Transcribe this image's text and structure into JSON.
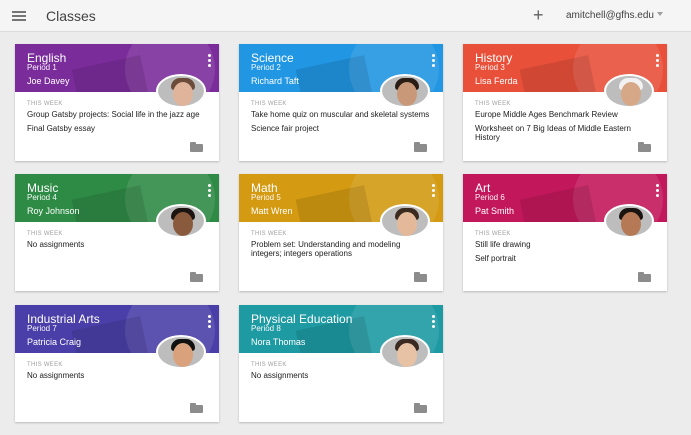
{
  "header": {
    "title": "Classes",
    "add_icon": "plus-icon",
    "account": "amitchell@gfhs.edu"
  },
  "this_week_label": "THIS WEEK",
  "classes": [
    {
      "name": "English",
      "period": "Period 1",
      "teacher": "Joe Davey",
      "color": "#7b2c9b",
      "assignments": [
        "Group Gatsby projects: Social life in the jazz age",
        "Final Gatsby essay"
      ]
    },
    {
      "name": "Science",
      "period": "Period 2",
      "teacher": "Richard Taft",
      "color": "#2196e3",
      "assignments": [
        "Take home quiz on muscular and skeletal systems",
        "Science fair project"
      ]
    },
    {
      "name": "History",
      "period": "Period 3",
      "teacher": "Lisa Ferda",
      "color": "#e8503a",
      "assignments": [
        "Europe Middle Ages Benchmark Review",
        "Worksheet on 7 Big Ideas of Middle Eastern History"
      ]
    },
    {
      "name": "Music",
      "period": "Period 4",
      "teacher": "Roy Johnson",
      "color": "#2e8b45",
      "assignments": [
        "No assignments"
      ]
    },
    {
      "name": "Math",
      "period": "Period 5",
      "teacher": "Matt Wren",
      "color": "#d39a12",
      "assignments": [
        "Problem set: Understanding and modeling integers; integers operations"
      ]
    },
    {
      "name": "Art",
      "period": "Period 6",
      "teacher": "Pat Smith",
      "color": "#c2185b",
      "assignments": [
        "Still life drawing",
        "Self portrait"
      ]
    },
    {
      "name": "Industrial Arts",
      "period": "Period 7",
      "teacher": "Patricia Craig",
      "color": "#4a3fa8",
      "assignments": [
        "No assignments"
      ]
    },
    {
      "name": "Physical Education",
      "period": "Period 8",
      "teacher": "Nora Thomas",
      "color": "#1e9aa3",
      "assignments": [
        "No assignments"
      ]
    }
  ]
}
